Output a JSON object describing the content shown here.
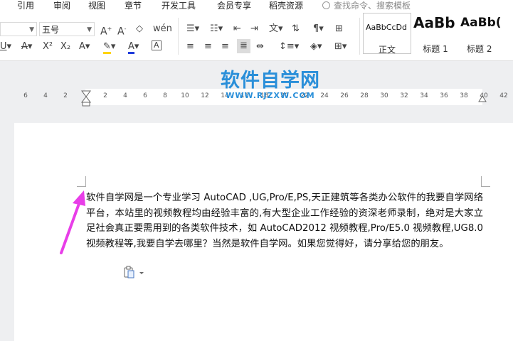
{
  "menu": {
    "items": [
      "引用",
      "审阅",
      "视图",
      "章节",
      "开发工具",
      "会员专享",
      "稻壳资源"
    ],
    "search_placeholder": "查找命令、搜索模板"
  },
  "toolbar": {
    "font_size": "五号",
    "line_spacing_icon": "line-spacing-icon"
  },
  "styles": [
    {
      "sample": "AaBbCcDd",
      "name": "正文"
    },
    {
      "sample": "AaBb",
      "name": "标题 1"
    },
    {
      "sample": "AaBb(",
      "name": "标题 2"
    }
  ],
  "ruler": {
    "ticks": [
      "6",
      "4",
      "2",
      "2",
      "4",
      "6",
      "8",
      "10",
      "12",
      "14",
      "16",
      "18",
      "20",
      "22",
      "24",
      "26",
      "28",
      "30",
      "32",
      "34",
      "36",
      "38",
      "40",
      "42"
    ]
  },
  "watermark": {
    "title": "软件自学网",
    "url": "WWW.RJZXW.COM"
  },
  "document": {
    "paragraph": "软件自学网是一个专业学习 AutoCAD ,UG,Pro/E,PS,天正建筑等各类办公软件的我要自学网络平台，本站里的视频教程均由经验丰富的,有大型企业工作经验的资深老师录制，绝对是大家立足社会真正要需用到的各类软件技术，如 AutoCAD2012 视频教程,Pro/E5.0 视频教程,UG8.0 视频教程等,我要自学去哪里？当然是软件自学网。如果您觉得好，请分享给您的朋友。"
  },
  "colors": {
    "annotation_arrow": "#e83ee8",
    "watermark": "#2a8fd9",
    "highlight": "#ffd400",
    "font_color": "#1f3bdb"
  }
}
